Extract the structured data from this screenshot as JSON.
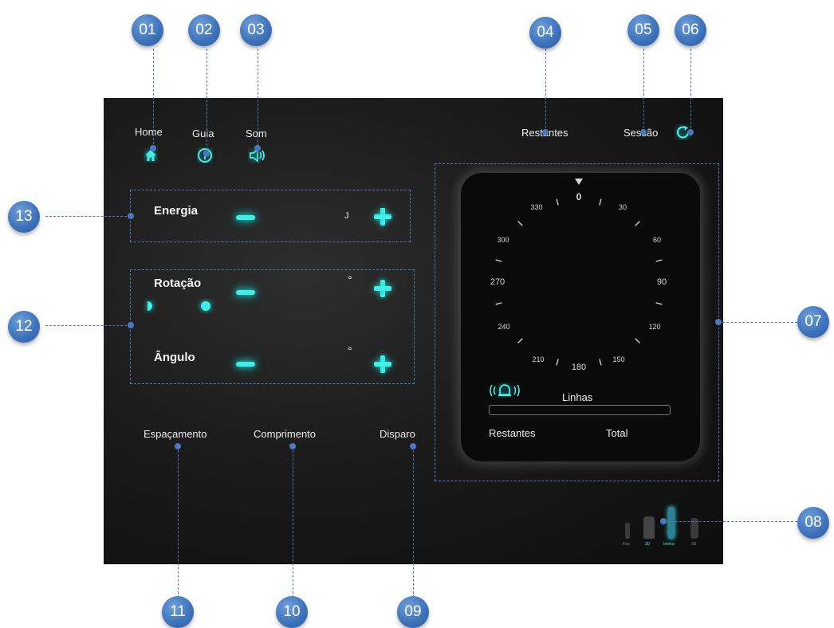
{
  "header": {
    "home_label": "Home",
    "guide_label": "Guia",
    "sound_label": "Som",
    "remaining_label": "Restantes",
    "session_label": "Sessão"
  },
  "energy": {
    "label": "Energia",
    "unit": "J"
  },
  "rotation": {
    "label": "Rotação",
    "unit": "°"
  },
  "angle": {
    "label": "Ângulo",
    "unit": "°"
  },
  "bottom": {
    "spacing_label": "Espaçamento",
    "length_label": "Comprimento",
    "trigger_label": "Disparo"
  },
  "dial": {
    "top_value": "0",
    "numbers": [
      "0",
      "30",
      "60",
      "90",
      "120",
      "150",
      "180",
      "210",
      "240",
      "270",
      "300",
      "330"
    ],
    "lines_label": "Linhas",
    "remaining_label": "Restantes",
    "total_label": "Total"
  },
  "tools": {
    "labels": [
      "Fan",
      "2D",
      "Intima",
      "3D"
    ]
  },
  "callouts": [
    "01",
    "02",
    "03",
    "04",
    "05",
    "06",
    "07",
    "08",
    "09",
    "10",
    "11",
    "12",
    "13"
  ],
  "colors": {
    "accent": "#3ef0e8",
    "callout": "#3f74bd",
    "background": "#151515"
  },
  "icons": [
    "home-icon",
    "info-icon",
    "speaker-icon",
    "refresh-icon",
    "alarm-bell-icon",
    "moon-phase-icon"
  ]
}
